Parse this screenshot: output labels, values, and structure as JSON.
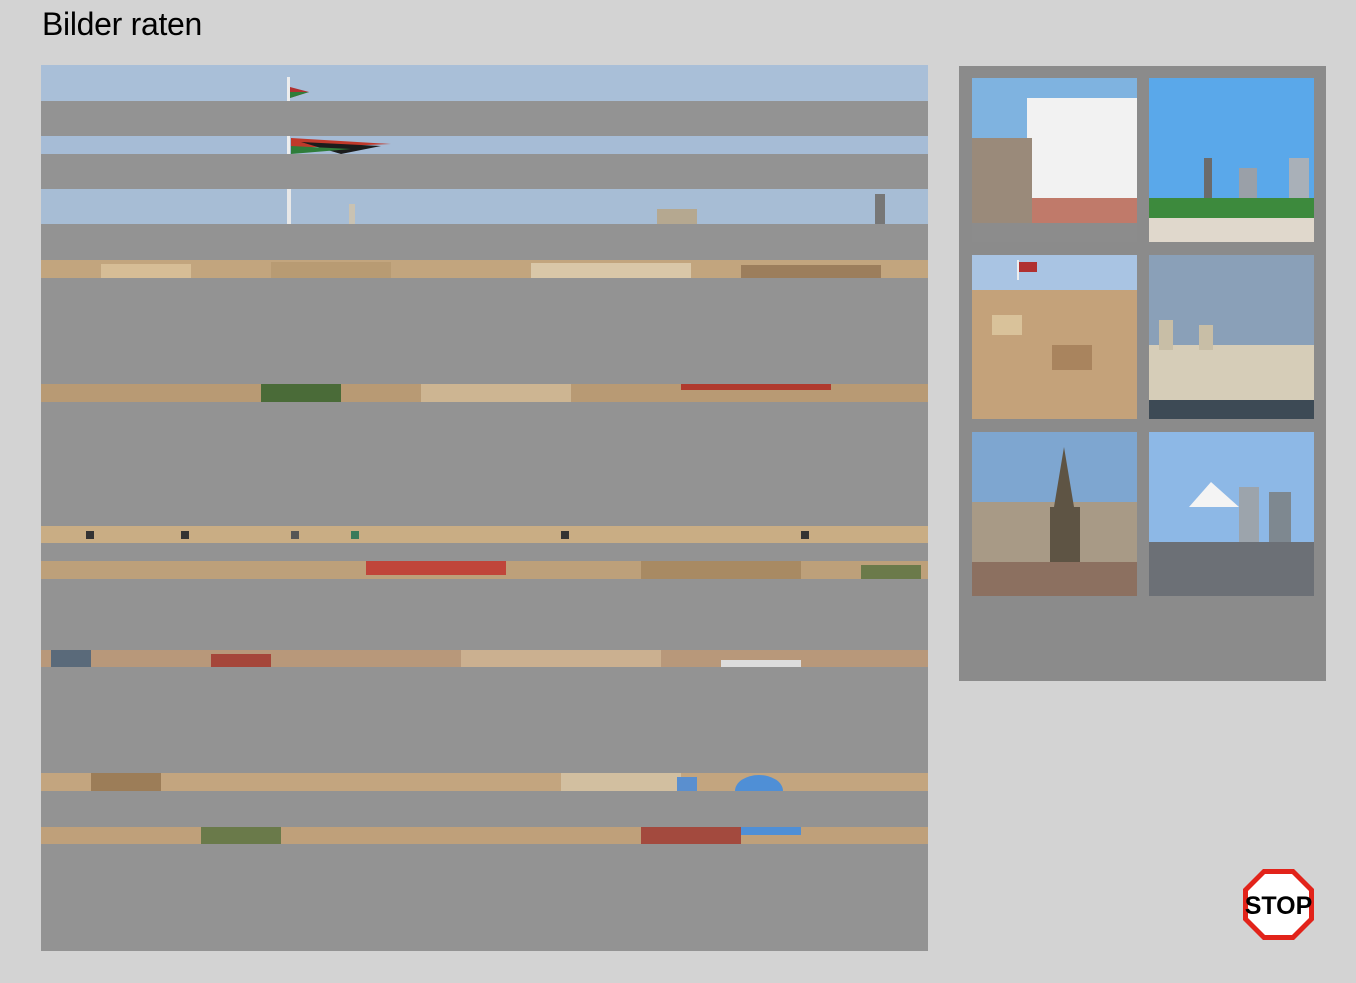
{
  "title": "Bilder raten",
  "stop_label": "STOP",
  "colors": {
    "background": "#d3d3d3",
    "cover": "#939393",
    "panel": "#8b8b8b",
    "stop_red": "#e2231a"
  },
  "main_image": {
    "name": "hidden-photo-amman",
    "revealed_strips": [
      {
        "scene": "sky-flag-top"
      },
      {
        "scene": "sky-flag-bottom"
      },
      {
        "scene": "sky-rooftops"
      },
      {
        "scene": "houses"
      },
      {
        "scene": "houses-trees"
      },
      {
        "scene": "houses-windows"
      },
      {
        "scene": "houses-red-roof"
      },
      {
        "scene": "houses-dense"
      },
      {
        "scene": "houses-blue-dome"
      },
      {
        "scene": "houses-blue-dome-base"
      }
    ]
  },
  "thumbnails": [
    {
      "icon": "colonial-street-photo"
    },
    {
      "icon": "modern-skyline-photo"
    },
    {
      "icon": "hillside-city-flag-photo"
    },
    {
      "icon": "waterfront-buildings-photo"
    },
    {
      "icon": "cathedral-spire-photo"
    },
    {
      "icon": "mountain-skyline-photo"
    }
  ]
}
